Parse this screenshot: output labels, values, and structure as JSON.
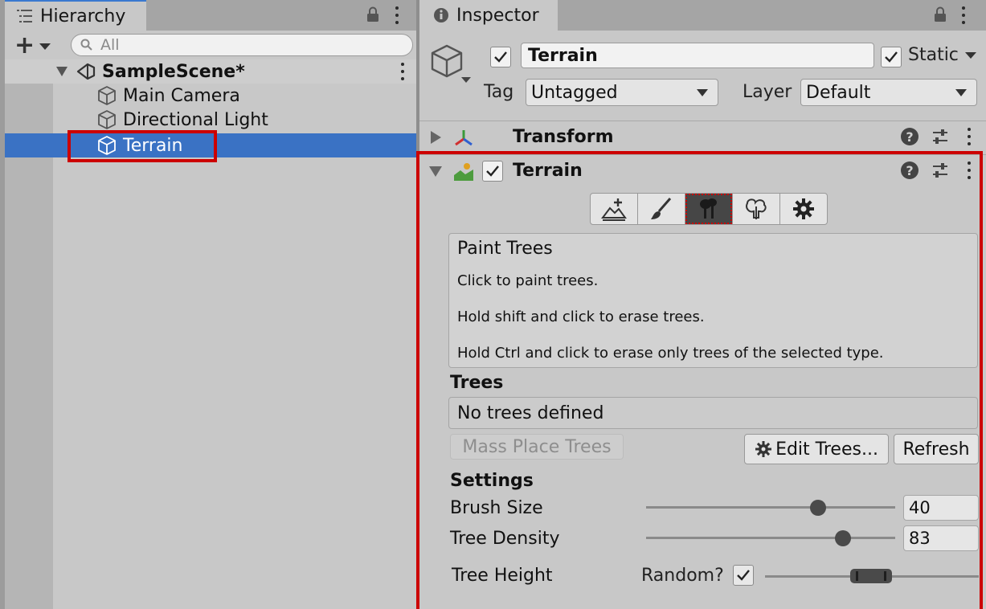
{
  "hierarchy": {
    "tab_label": "Hierarchy",
    "search_placeholder": "All",
    "scene_name": "SampleScene*",
    "items": [
      {
        "label": "Main Camera"
      },
      {
        "label": "Directional Light"
      },
      {
        "label": "Terrain"
      }
    ],
    "selected_item": "Terrain"
  },
  "inspector": {
    "tab_label": "Inspector",
    "object_name": "Terrain",
    "active_checked": true,
    "static_checked": true,
    "static_label": "Static",
    "tag_label": "Tag",
    "tag_value": "Untagged",
    "layer_label": "Layer",
    "layer_value": "Default",
    "components": {
      "transform": {
        "title": "Transform"
      },
      "terrain": {
        "title": "Terrain",
        "enabled": true
      }
    },
    "tools": [
      {
        "icon": "raise-terrain-icon"
      },
      {
        "icon": "paint-brush-icon"
      },
      {
        "icon": "paint-trees-icon",
        "active": true
      },
      {
        "icon": "paint-details-icon"
      },
      {
        "icon": "terrain-settings-gear-icon"
      }
    ],
    "help_box": {
      "title": "Paint Trees",
      "lines": [
        "Click to paint trees.",
        "Hold shift and click to erase trees.",
        "Hold Ctrl and click to erase only trees of the selected type."
      ]
    },
    "trees": {
      "heading": "Trees",
      "empty_text": "No trees defined",
      "mass_place_label": "Mass Place Trees",
      "edit_trees_label": "Edit Trees...",
      "refresh_label": "Refresh"
    },
    "settings": {
      "heading": "Settings",
      "brush_size_label": "Brush Size",
      "brush_size_value": "40",
      "brush_size_fraction": 0.69,
      "tree_density_label": "Tree Density",
      "tree_density_value": "83",
      "tree_density_fraction": 0.79,
      "tree_height_label": "Tree Height",
      "random_label": "Random?",
      "random_checked": true
    }
  },
  "colors": {
    "selection": "#3a72c4",
    "highlight_box": "#cc0000",
    "active_tab_line": "#3a79d0"
  }
}
